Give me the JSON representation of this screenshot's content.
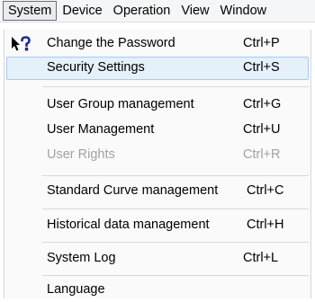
{
  "menubar": {
    "items": [
      {
        "label": "System"
      },
      {
        "label": "Device"
      },
      {
        "label": "Operation"
      },
      {
        "label": "View"
      },
      {
        "label": "Window"
      }
    ]
  },
  "dropdown": {
    "items": [
      {
        "label": "Change the Password",
        "shortcut": "Ctrl+P"
      },
      {
        "label": "Security Settings",
        "shortcut": "Ctrl+S"
      },
      {
        "label": "User Group management",
        "shortcut": "Ctrl+G"
      },
      {
        "label": "User Management",
        "shortcut": "Ctrl+U"
      },
      {
        "label": "User Rights",
        "shortcut": "Ctrl+R"
      },
      {
        "label": "Standard Curve management",
        "shortcut": "Ctrl+C"
      },
      {
        "label": "Historical data management",
        "shortcut": "Ctrl+H"
      },
      {
        "label": "System Log",
        "shortcut": "Ctrl+L"
      },
      {
        "label": "Language",
        "shortcut": ""
      }
    ]
  },
  "icons": {
    "help_pointer": "help-pointer-icon"
  },
  "colors": {
    "highlight_bg": "#e5f0fb",
    "highlight_border": "#a9cbee",
    "disabled_text": "#a2a2a2"
  }
}
